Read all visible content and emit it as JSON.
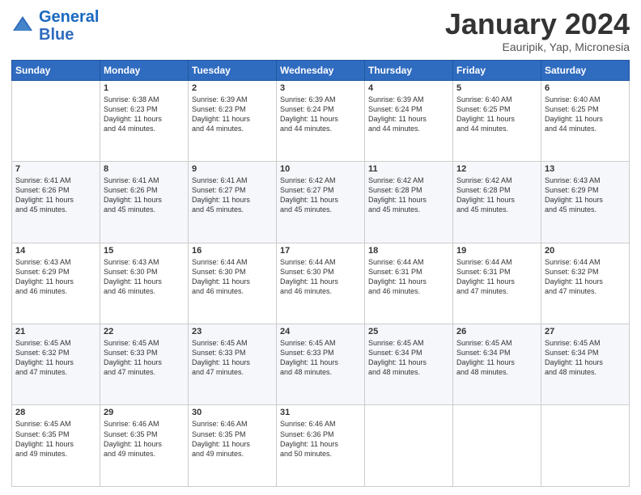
{
  "logo": {
    "line1": "General",
    "line2": "Blue"
  },
  "header": {
    "title": "January 2024",
    "subtitle": "Eauripik, Yap, Micronesia"
  },
  "weekdays": [
    "Sunday",
    "Monday",
    "Tuesday",
    "Wednesday",
    "Thursday",
    "Friday",
    "Saturday"
  ],
  "weeks": [
    [
      {
        "day": "",
        "sunrise": "",
        "sunset": "",
        "daylight": ""
      },
      {
        "day": "1",
        "sunrise": "Sunrise: 6:38 AM",
        "sunset": "Sunset: 6:23 PM",
        "daylight": "Daylight: 11 hours and 44 minutes."
      },
      {
        "day": "2",
        "sunrise": "Sunrise: 6:39 AM",
        "sunset": "Sunset: 6:23 PM",
        "daylight": "Daylight: 11 hours and 44 minutes."
      },
      {
        "day": "3",
        "sunrise": "Sunrise: 6:39 AM",
        "sunset": "Sunset: 6:24 PM",
        "daylight": "Daylight: 11 hours and 44 minutes."
      },
      {
        "day": "4",
        "sunrise": "Sunrise: 6:39 AM",
        "sunset": "Sunset: 6:24 PM",
        "daylight": "Daylight: 11 hours and 44 minutes."
      },
      {
        "day": "5",
        "sunrise": "Sunrise: 6:40 AM",
        "sunset": "Sunset: 6:25 PM",
        "daylight": "Daylight: 11 hours and 44 minutes."
      },
      {
        "day": "6",
        "sunrise": "Sunrise: 6:40 AM",
        "sunset": "Sunset: 6:25 PM",
        "daylight": "Daylight: 11 hours and 44 minutes."
      }
    ],
    [
      {
        "day": "7",
        "sunrise": "Sunrise: 6:41 AM",
        "sunset": "Sunset: 6:26 PM",
        "daylight": "Daylight: 11 hours and 45 minutes."
      },
      {
        "day": "8",
        "sunrise": "Sunrise: 6:41 AM",
        "sunset": "Sunset: 6:26 PM",
        "daylight": "Daylight: 11 hours and 45 minutes."
      },
      {
        "day": "9",
        "sunrise": "Sunrise: 6:41 AM",
        "sunset": "Sunset: 6:27 PM",
        "daylight": "Daylight: 11 hours and 45 minutes."
      },
      {
        "day": "10",
        "sunrise": "Sunrise: 6:42 AM",
        "sunset": "Sunset: 6:27 PM",
        "daylight": "Daylight: 11 hours and 45 minutes."
      },
      {
        "day": "11",
        "sunrise": "Sunrise: 6:42 AM",
        "sunset": "Sunset: 6:28 PM",
        "daylight": "Daylight: 11 hours and 45 minutes."
      },
      {
        "day": "12",
        "sunrise": "Sunrise: 6:42 AM",
        "sunset": "Sunset: 6:28 PM",
        "daylight": "Daylight: 11 hours and 45 minutes."
      },
      {
        "day": "13",
        "sunrise": "Sunrise: 6:43 AM",
        "sunset": "Sunset: 6:29 PM",
        "daylight": "Daylight: 11 hours and 45 minutes."
      }
    ],
    [
      {
        "day": "14",
        "sunrise": "Sunrise: 6:43 AM",
        "sunset": "Sunset: 6:29 PM",
        "daylight": "Daylight: 11 hours and 46 minutes."
      },
      {
        "day": "15",
        "sunrise": "Sunrise: 6:43 AM",
        "sunset": "Sunset: 6:30 PM",
        "daylight": "Daylight: 11 hours and 46 minutes."
      },
      {
        "day": "16",
        "sunrise": "Sunrise: 6:44 AM",
        "sunset": "Sunset: 6:30 PM",
        "daylight": "Daylight: 11 hours and 46 minutes."
      },
      {
        "day": "17",
        "sunrise": "Sunrise: 6:44 AM",
        "sunset": "Sunset: 6:30 PM",
        "daylight": "Daylight: 11 hours and 46 minutes."
      },
      {
        "day": "18",
        "sunrise": "Sunrise: 6:44 AM",
        "sunset": "Sunset: 6:31 PM",
        "daylight": "Daylight: 11 hours and 46 minutes."
      },
      {
        "day": "19",
        "sunrise": "Sunrise: 6:44 AM",
        "sunset": "Sunset: 6:31 PM",
        "daylight": "Daylight: 11 hours and 47 minutes."
      },
      {
        "day": "20",
        "sunrise": "Sunrise: 6:44 AM",
        "sunset": "Sunset: 6:32 PM",
        "daylight": "Daylight: 11 hours and 47 minutes."
      }
    ],
    [
      {
        "day": "21",
        "sunrise": "Sunrise: 6:45 AM",
        "sunset": "Sunset: 6:32 PM",
        "daylight": "Daylight: 11 hours and 47 minutes."
      },
      {
        "day": "22",
        "sunrise": "Sunrise: 6:45 AM",
        "sunset": "Sunset: 6:33 PM",
        "daylight": "Daylight: 11 hours and 47 minutes."
      },
      {
        "day": "23",
        "sunrise": "Sunrise: 6:45 AM",
        "sunset": "Sunset: 6:33 PM",
        "daylight": "Daylight: 11 hours and 47 minutes."
      },
      {
        "day": "24",
        "sunrise": "Sunrise: 6:45 AM",
        "sunset": "Sunset: 6:33 PM",
        "daylight": "Daylight: 11 hours and 48 minutes."
      },
      {
        "day": "25",
        "sunrise": "Sunrise: 6:45 AM",
        "sunset": "Sunset: 6:34 PM",
        "daylight": "Daylight: 11 hours and 48 minutes."
      },
      {
        "day": "26",
        "sunrise": "Sunrise: 6:45 AM",
        "sunset": "Sunset: 6:34 PM",
        "daylight": "Daylight: 11 hours and 48 minutes."
      },
      {
        "day": "27",
        "sunrise": "Sunrise: 6:45 AM",
        "sunset": "Sunset: 6:34 PM",
        "daylight": "Daylight: 11 hours and 48 minutes."
      }
    ],
    [
      {
        "day": "28",
        "sunrise": "Sunrise: 6:45 AM",
        "sunset": "Sunset: 6:35 PM",
        "daylight": "Daylight: 11 hours and 49 minutes."
      },
      {
        "day": "29",
        "sunrise": "Sunrise: 6:46 AM",
        "sunset": "Sunset: 6:35 PM",
        "daylight": "Daylight: 11 hours and 49 minutes."
      },
      {
        "day": "30",
        "sunrise": "Sunrise: 6:46 AM",
        "sunset": "Sunset: 6:35 PM",
        "daylight": "Daylight: 11 hours and 49 minutes."
      },
      {
        "day": "31",
        "sunrise": "Sunrise: 6:46 AM",
        "sunset": "Sunset: 6:36 PM",
        "daylight": "Daylight: 11 hours and 50 minutes."
      },
      {
        "day": "",
        "sunrise": "",
        "sunset": "",
        "daylight": ""
      },
      {
        "day": "",
        "sunrise": "",
        "sunset": "",
        "daylight": ""
      },
      {
        "day": "",
        "sunrise": "",
        "sunset": "",
        "daylight": ""
      }
    ]
  ]
}
